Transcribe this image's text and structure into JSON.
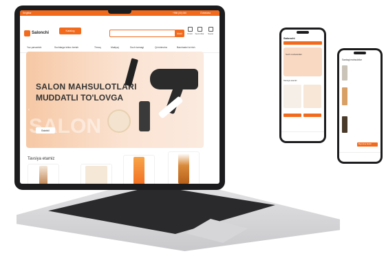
{
  "site": {
    "top_strip": {
      "left": "Sergiltlar",
      "right_a": "+998 (00) 000",
      "right_b": "O'zbekcha"
    },
    "logo": "Salonchi",
    "catalog_button": "Katalog",
    "search": {
      "button": "Izlash"
    },
    "header_icons": [
      "Kirish",
      "Sevimlilar",
      "Savat"
    ],
    "nav": [
      "Yuz parvarishi",
      "Sochlarga ishlov berish",
      "Tirnoq",
      "Makiyaj",
      "Soch turmagi",
      "Qo'shimcha",
      "Barchasini ko'rish"
    ],
    "banner": {
      "title": "SALON MAHSULOTLARI",
      "subtitle": "MUDDATLI TO'LOVGA",
      "watermark": "SALON",
      "button": "Batafsil"
    },
    "section_title": "Tavsiya etamiz"
  },
  "phone1": {
    "logo": "Salonchi",
    "banner": "Soch mahsulotlari",
    "section": "Tavsiya etamiz"
  },
  "phone2": {
    "header": "Savdagi mahsulotlar",
    "cta": "Buyurtma berish"
  },
  "colors": {
    "brand": "#f26b1d",
    "bezel": "#1c1c1e"
  }
}
